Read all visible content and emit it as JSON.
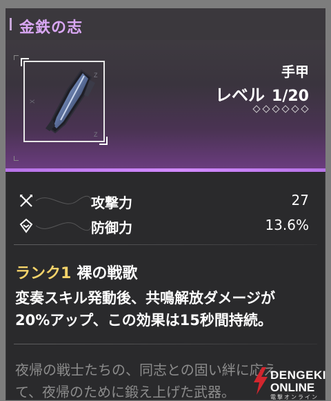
{
  "item": {
    "title": "金鉄の志",
    "type": "手甲",
    "level_label": "レベル",
    "level_value": "1",
    "level_max": "/20",
    "refine_slots": 6,
    "icon": "gauntlet-icon"
  },
  "stats": [
    {
      "label": "攻撃力",
      "value": "27",
      "icon": "attack-icon"
    },
    {
      "label": "防御力",
      "value": "13.6%",
      "icon": "defense-icon"
    }
  ],
  "effect": {
    "rank": "ランク1",
    "name": "裸の戦歌",
    "description_line1": "変奏スキル発動後、共鳴解放ダメージが",
    "description_line2": "20%アップ、この効果は15秒間持続。"
  },
  "lore": {
    "line1": "夜帰の戦士たちの、同志との固い絆に応え",
    "line2": "て、夜帰のために鍛え上げた武器。"
  },
  "watermark": {
    "top": "DENGEKI",
    "bottom": "ONLINE",
    "sub": "電撃オンライン"
  },
  "colors": {
    "title": "#d8a6f2",
    "rank": "#f4d36a",
    "accent_line": "#c77dfa"
  }
}
